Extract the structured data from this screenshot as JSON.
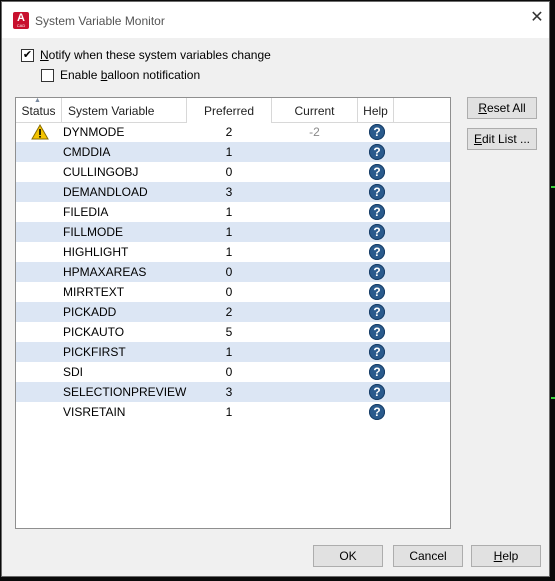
{
  "window": {
    "title": "System Variable Monitor"
  },
  "options": {
    "notify": {
      "pre": "",
      "accel": "N",
      "post": "otify when these system variables change",
      "checked": true
    },
    "balloon": {
      "pre": "Enable ",
      "accel": "b",
      "post": "alloon notification",
      "checked": false
    }
  },
  "table": {
    "headers": {
      "status": "Status",
      "variable": "System Variable",
      "preferred": "Preferred",
      "current": "Current",
      "help": "Help"
    },
    "rows": [
      {
        "name": "DYNMODE",
        "preferred": "2",
        "current": "-2",
        "warning": true
      },
      {
        "name": "CMDDIA",
        "preferred": "1",
        "current": ""
      },
      {
        "name": "CULLINGOBJ",
        "preferred": "0",
        "current": ""
      },
      {
        "name": "DEMANDLOAD",
        "preferred": "3",
        "current": ""
      },
      {
        "name": "FILEDIA",
        "preferred": "1",
        "current": ""
      },
      {
        "name": "FILLMODE",
        "preferred": "1",
        "current": ""
      },
      {
        "name": "HIGHLIGHT",
        "preferred": "1",
        "current": ""
      },
      {
        "name": "HPMAXAREAS",
        "preferred": "0",
        "current": ""
      },
      {
        "name": "MIRRTEXT",
        "preferred": "0",
        "current": ""
      },
      {
        "name": "PICKADD",
        "preferred": "2",
        "current": ""
      },
      {
        "name": "PICKAUTO",
        "preferred": "5",
        "current": ""
      },
      {
        "name": "PICKFIRST",
        "preferred": "1",
        "current": ""
      },
      {
        "name": "SDI",
        "preferred": "0",
        "current": ""
      },
      {
        "name": "SELECTIONPREVIEW",
        "preferred": "3",
        "current": ""
      },
      {
        "name": "VISRETAIN",
        "preferred": "1",
        "current": ""
      }
    ]
  },
  "buttons": {
    "reset_all": {
      "accel": "R",
      "rest": "eset All"
    },
    "edit_list": {
      "accel": "E",
      "rest": "dit List ..."
    },
    "ok": "OK",
    "cancel": "Cancel",
    "help": {
      "accel": "H",
      "rest": "elp"
    }
  },
  "icons": {
    "app": "autocad-app-icon",
    "warning": "warning-icon",
    "help": "help-icon",
    "close": "close-icon"
  },
  "colors": {
    "alt_row": "#dce6f4",
    "help_icon": "#2a5a8c",
    "warning": "#f5c400"
  }
}
